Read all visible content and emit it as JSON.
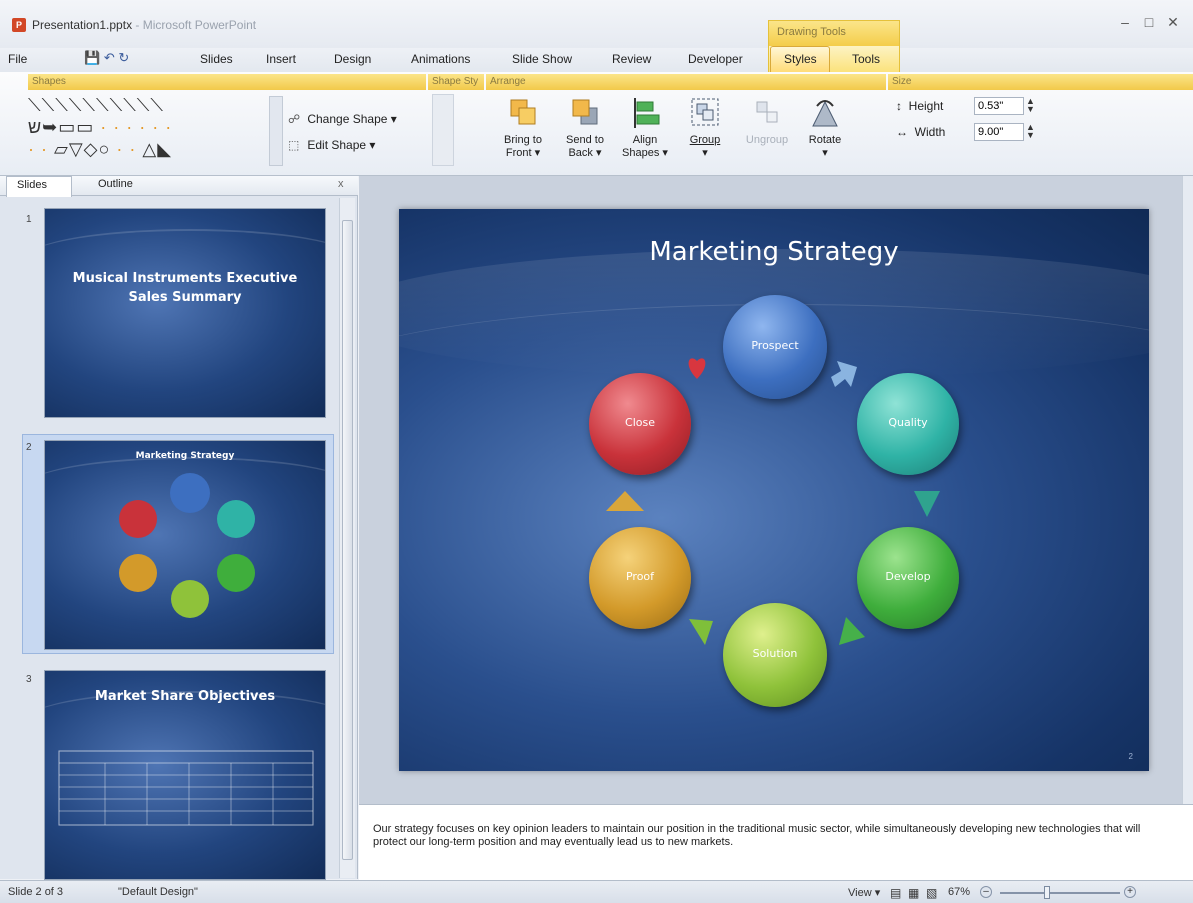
{
  "window": {
    "doc_name": "Presentation1.pptx",
    "app_name": "- Microsoft PowerPoint",
    "context_header": "Drawing Tools",
    "controls": [
      "–",
      "□",
      "✕"
    ]
  },
  "tabs": [
    "File",
    "Slides",
    "Insert",
    "Design",
    "Animations",
    "Slide Show",
    "Review",
    "Developer",
    "Styles",
    "Tools"
  ],
  "ribbon": {
    "groups": {
      "shapes": "Shapes",
      "shape_styles": "Shape Sty",
      "arrange": "Arrange",
      "size": "Size"
    },
    "change_shape": "Change Shape",
    "edit_shape": "Edit Shape",
    "bring_to_front": [
      "Bring to",
      "Front"
    ],
    "send_to_back": [
      "Send to",
      "Back"
    ],
    "align_shapes": [
      "Align",
      "Shapes"
    ],
    "group": "Group",
    "ungroup": "Ungroup",
    "rotate": "Rotate",
    "height_label": "Height",
    "height_value": "0.53\"",
    "width_label": "Width",
    "width_value": "9.00\""
  },
  "left_panel": {
    "tab_slides": "Slides",
    "tab_outline": "Outline",
    "close": "x",
    "slides": [
      {
        "num": "1",
        "title_line1": "Musical Instruments Executive",
        "title_line2": "Sales Summary"
      },
      {
        "num": "2",
        "title": "Marketing Strategy"
      },
      {
        "num": "3",
        "title": "Market Share Objectives"
      }
    ]
  },
  "slide": {
    "title": "Marketing Strategy",
    "steps": [
      "Prospect",
      "Quality",
      "Develop",
      "Solution",
      "Proof",
      "Close"
    ],
    "page_number": "2"
  },
  "notes": "Our strategy focuses on key opinion leaders to maintain our position in the traditional music sector, while simultaneously developing new technologies that will protect our long-term position and may eventually lead us to new markets.",
  "status": {
    "slide_info": "Slide 2 of 3",
    "theme": "\"Default Design\"",
    "view_label": "View",
    "zoom": "67%"
  },
  "colors": {
    "prospect": "#3d6fc0",
    "quality": "#2fb3a6",
    "develop": "#3fae3c",
    "solution": "#8fc23a",
    "proof": "#d39a2a",
    "close": "#c9323a"
  }
}
